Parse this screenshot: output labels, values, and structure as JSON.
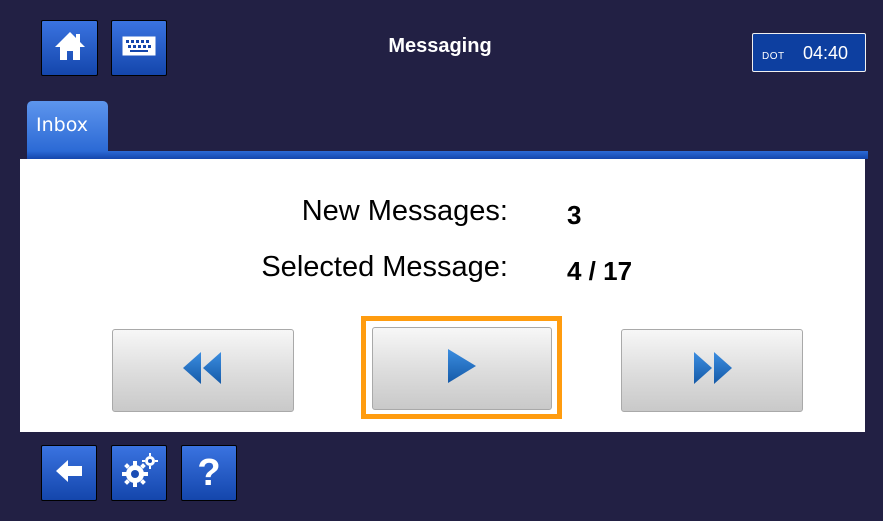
{
  "header": {
    "title": "Messaging",
    "clock_prefix": "DOT",
    "clock_time": "04:40",
    "home_icon": "home-icon",
    "keyboard_icon": "keyboard-icon"
  },
  "tabs": [
    {
      "label": "Inbox",
      "active": true
    }
  ],
  "main": {
    "new_messages_label": "New Messages:",
    "new_messages_value": "3",
    "selected_message_label": "Selected Message:",
    "selected_message_value": "4 / 17"
  },
  "controls": {
    "prev_icon": "rewind-icon",
    "play_icon": "play-icon",
    "next_icon": "fast-forward-icon",
    "focused": "play"
  },
  "footer": {
    "back_icon": "back-arrow-icon",
    "settings_icon": "gears-icon",
    "help_label": "?"
  },
  "colors": {
    "background": "#222044",
    "button_blue": "#1f55c0",
    "focus_orange": "#ff9c0f",
    "icon_blue": "#1f6fbf"
  }
}
